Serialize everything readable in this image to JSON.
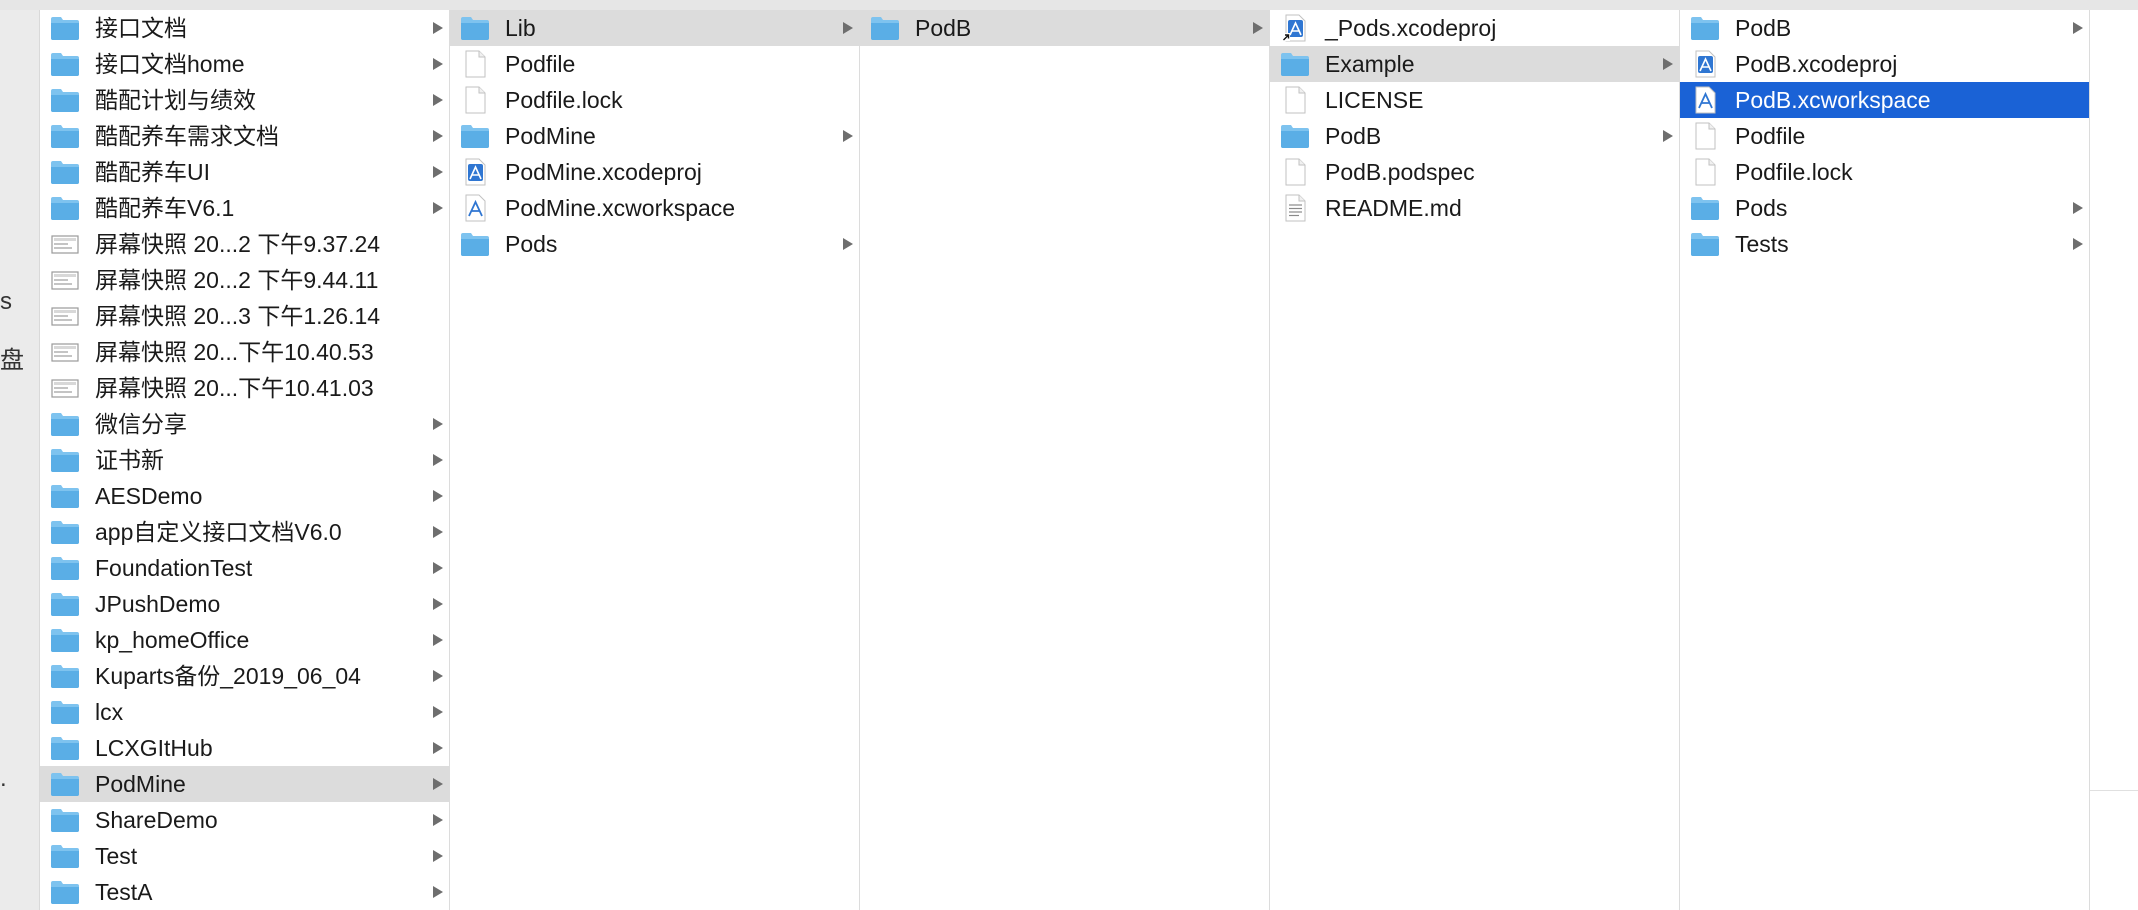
{
  "sidebar": {
    "fragments": [
      "s",
      "盘",
      "."
    ]
  },
  "columns": [
    {
      "items": [
        {
          "name": "接口文档",
          "kind": "folder",
          "has_children": true,
          "state": ""
        },
        {
          "name": "接口文档home",
          "kind": "folder",
          "has_children": true,
          "state": ""
        },
        {
          "name": "酷配计划与绩效",
          "kind": "folder",
          "has_children": true,
          "state": ""
        },
        {
          "name": "酷配养车需求文档",
          "kind": "folder",
          "has_children": true,
          "state": ""
        },
        {
          "name": "酷配养车UI",
          "kind": "folder",
          "has_children": true,
          "state": ""
        },
        {
          "name": "酷配养车V6.1",
          "kind": "folder",
          "has_children": true,
          "state": ""
        },
        {
          "name": "屏幕快照 20...2 下午9.37.24",
          "kind": "screenshot",
          "has_children": false,
          "state": ""
        },
        {
          "name": "屏幕快照 20...2 下午9.44.11",
          "kind": "screenshot",
          "has_children": false,
          "state": ""
        },
        {
          "name": "屏幕快照 20...3 下午1.26.14",
          "kind": "screenshot",
          "has_children": false,
          "state": ""
        },
        {
          "name": "屏幕快照 20...下午10.40.53",
          "kind": "screenshot",
          "has_children": false,
          "state": ""
        },
        {
          "name": "屏幕快照 20...下午10.41.03",
          "kind": "screenshot",
          "has_children": false,
          "state": ""
        },
        {
          "name": "微信分享",
          "kind": "folder",
          "has_children": true,
          "state": ""
        },
        {
          "name": "证书新",
          "kind": "folder",
          "has_children": true,
          "state": ""
        },
        {
          "name": "AESDemo",
          "kind": "folder",
          "has_children": true,
          "state": ""
        },
        {
          "name": "app自定义接口文档V6.0",
          "kind": "folder",
          "has_children": true,
          "state": ""
        },
        {
          "name": "FoundationTest",
          "kind": "folder",
          "has_children": true,
          "state": ""
        },
        {
          "name": "JPushDemo",
          "kind": "folder",
          "has_children": true,
          "state": ""
        },
        {
          "name": "kp_homeOffice",
          "kind": "folder",
          "has_children": true,
          "state": ""
        },
        {
          "name": "Kuparts备份_2019_06_04",
          "kind": "folder",
          "has_children": true,
          "state": ""
        },
        {
          "name": "lcx",
          "kind": "folder",
          "has_children": true,
          "state": ""
        },
        {
          "name": "LCXGItHub",
          "kind": "folder",
          "has_children": true,
          "state": ""
        },
        {
          "name": "PodMine",
          "kind": "folder",
          "has_children": true,
          "state": "highlighted"
        },
        {
          "name": "ShareDemo",
          "kind": "folder",
          "has_children": true,
          "state": ""
        },
        {
          "name": "Test",
          "kind": "folder",
          "has_children": true,
          "state": ""
        },
        {
          "name": "TestA",
          "kind": "folder",
          "has_children": true,
          "state": ""
        }
      ]
    },
    {
      "items": [
        {
          "name": "Lib",
          "kind": "folder",
          "has_children": true,
          "state": "highlighted"
        },
        {
          "name": "Podfile",
          "kind": "file",
          "has_children": false,
          "state": ""
        },
        {
          "name": "Podfile.lock",
          "kind": "file",
          "has_children": false,
          "state": ""
        },
        {
          "name": "PodMine",
          "kind": "folder",
          "has_children": true,
          "state": ""
        },
        {
          "name": "PodMine.xcodeproj",
          "kind": "xcodeproj",
          "has_children": false,
          "state": ""
        },
        {
          "name": "PodMine.xcworkspace",
          "kind": "xcworkspace",
          "has_children": false,
          "state": ""
        },
        {
          "name": "Pods",
          "kind": "folder",
          "has_children": true,
          "state": ""
        }
      ]
    },
    {
      "items": [
        {
          "name": "PodB",
          "kind": "folder",
          "has_children": true,
          "state": "highlighted"
        }
      ]
    },
    {
      "items": [
        {
          "name": "_Pods.xcodeproj",
          "kind": "xcodeproj-alias",
          "has_children": false,
          "state": ""
        },
        {
          "name": "Example",
          "kind": "folder",
          "has_children": true,
          "state": "highlighted"
        },
        {
          "name": "LICENSE",
          "kind": "file",
          "has_children": false,
          "state": ""
        },
        {
          "name": "PodB",
          "kind": "folder",
          "has_children": true,
          "state": ""
        },
        {
          "name": "PodB.podspec",
          "kind": "file",
          "has_children": false,
          "state": ""
        },
        {
          "name": "README.md",
          "kind": "text",
          "has_children": false,
          "state": ""
        }
      ]
    },
    {
      "items": [
        {
          "name": "PodB",
          "kind": "folder",
          "has_children": true,
          "state": ""
        },
        {
          "name": "PodB.xcodeproj",
          "kind": "xcodeproj",
          "has_children": false,
          "state": ""
        },
        {
          "name": "PodB.xcworkspace",
          "kind": "xcworkspace",
          "has_children": false,
          "state": "selected"
        },
        {
          "name": "Podfile",
          "kind": "file",
          "has_children": false,
          "state": ""
        },
        {
          "name": "Podfile.lock",
          "kind": "file",
          "has_children": false,
          "state": ""
        },
        {
          "name": "Pods",
          "kind": "folder",
          "has_children": true,
          "state": ""
        },
        {
          "name": "Tests",
          "kind": "folder",
          "has_children": true,
          "state": ""
        }
      ]
    }
  ],
  "colors": {
    "selection": "#1a62d6",
    "highlight": "#dcdcdc",
    "folder": "#7ec3ef",
    "xcode_blue": "#2f76d2"
  }
}
